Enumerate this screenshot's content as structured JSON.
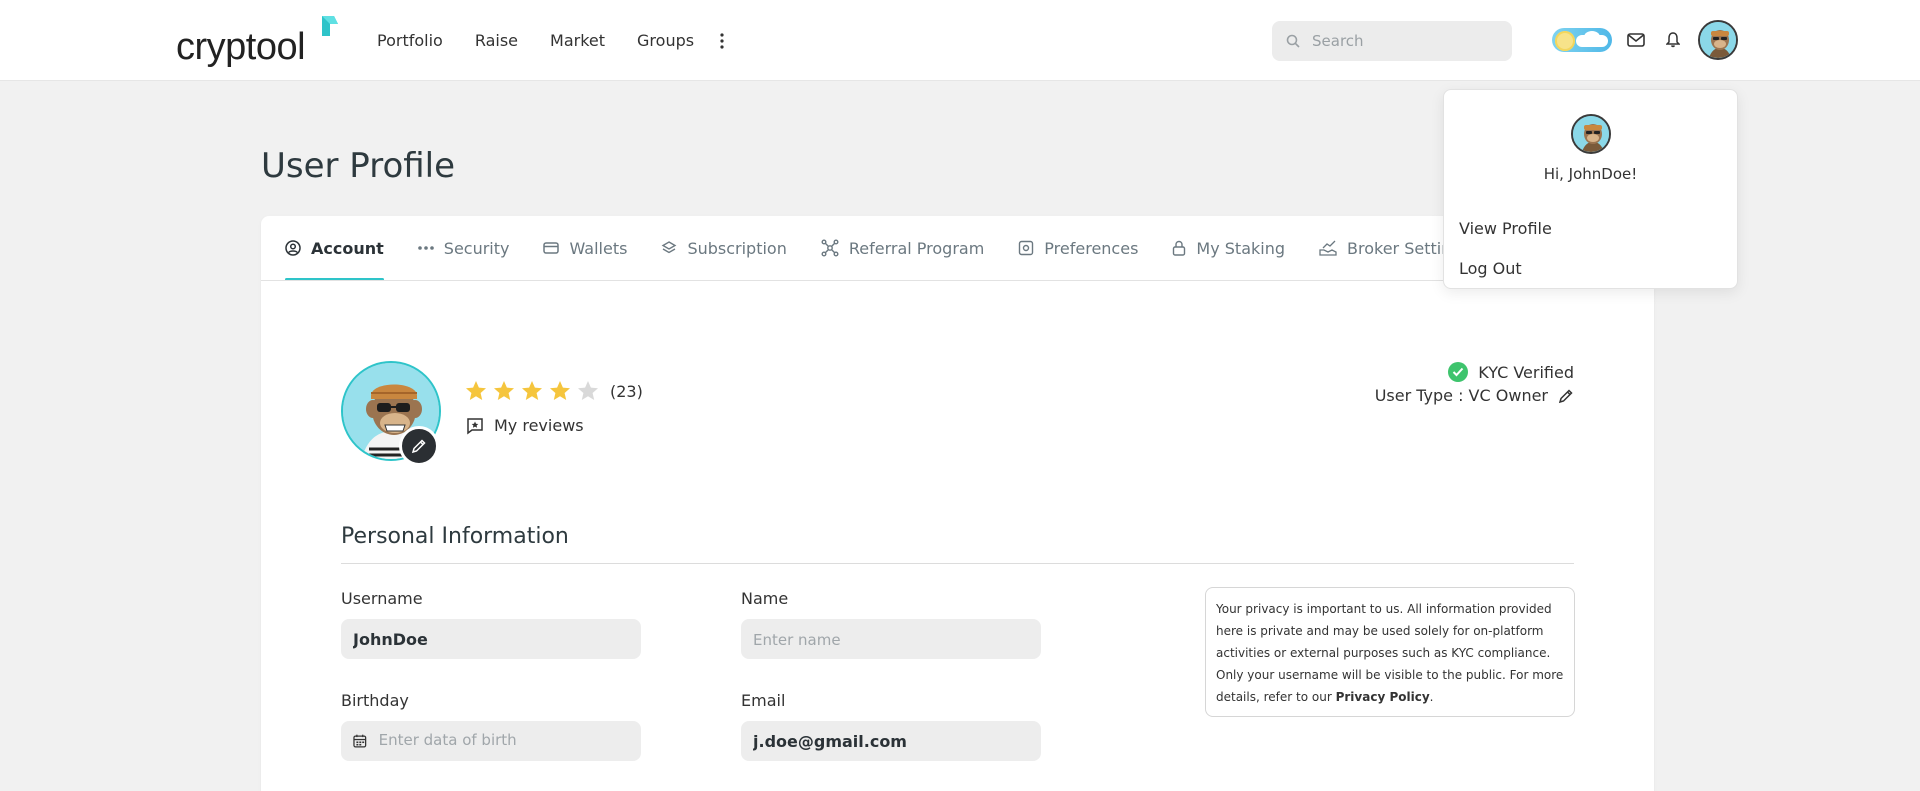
{
  "brand": {
    "name": "cryptool",
    "accent": "#2ec4c9"
  },
  "nav": {
    "items": [
      "Portfolio",
      "Raise",
      "Market",
      "Groups"
    ],
    "more_icon": "more-vertical-icon"
  },
  "search": {
    "placeholder": "Search"
  },
  "page": {
    "title": "User Profile"
  },
  "tabs": [
    {
      "label": "Account",
      "icon": "user-circle-icon",
      "active": true
    },
    {
      "label": "Security",
      "icon": "password-dots-icon",
      "active": false
    },
    {
      "label": "Wallets",
      "icon": "wallet-icon",
      "active": false
    },
    {
      "label": "Subscription",
      "icon": "layers-icon",
      "active": false
    },
    {
      "label": "Referral Program",
      "icon": "network-icon",
      "active": false
    },
    {
      "label": "Preferences",
      "icon": "settings-box-icon",
      "active": false
    },
    {
      "label": "My Staking",
      "icon": "lock-icon",
      "active": false
    },
    {
      "label": "Broker Settings",
      "icon": "chart-hand-icon",
      "active": false
    }
  ],
  "profile": {
    "rating": 4,
    "rating_max": 5,
    "rating_count": "(23)",
    "reviews_label": "My reviews",
    "kyc_label": "KYC Verified",
    "user_type": "User Type : VC Owner"
  },
  "personal": {
    "title": "Personal Information",
    "username_label": "Username",
    "username_value": "JohnDoe",
    "name_label": "Name",
    "name_placeholder": "Enter name",
    "birthday_label": "Birthday",
    "birthday_placeholder": "Enter data of birth",
    "email_label": "Email",
    "email_value": "j.doe@gmail.com"
  },
  "privacy": {
    "text": "Your privacy is important to us. All information provided here is private and may be used solely for on-platform activities or external purposes such as KYC compliance. Only your username will be visible to the public. For more details, refer to our ",
    "link": "Privacy Policy",
    "end": "."
  },
  "dropdown": {
    "greeting": "Hi, JohnDoe!",
    "view_profile": "View Profile",
    "log_out": "Log Out"
  },
  "colors": {
    "star_on": "#f5c53d",
    "star_off": "#d9d9d9",
    "kyc": "#3ec46d"
  }
}
